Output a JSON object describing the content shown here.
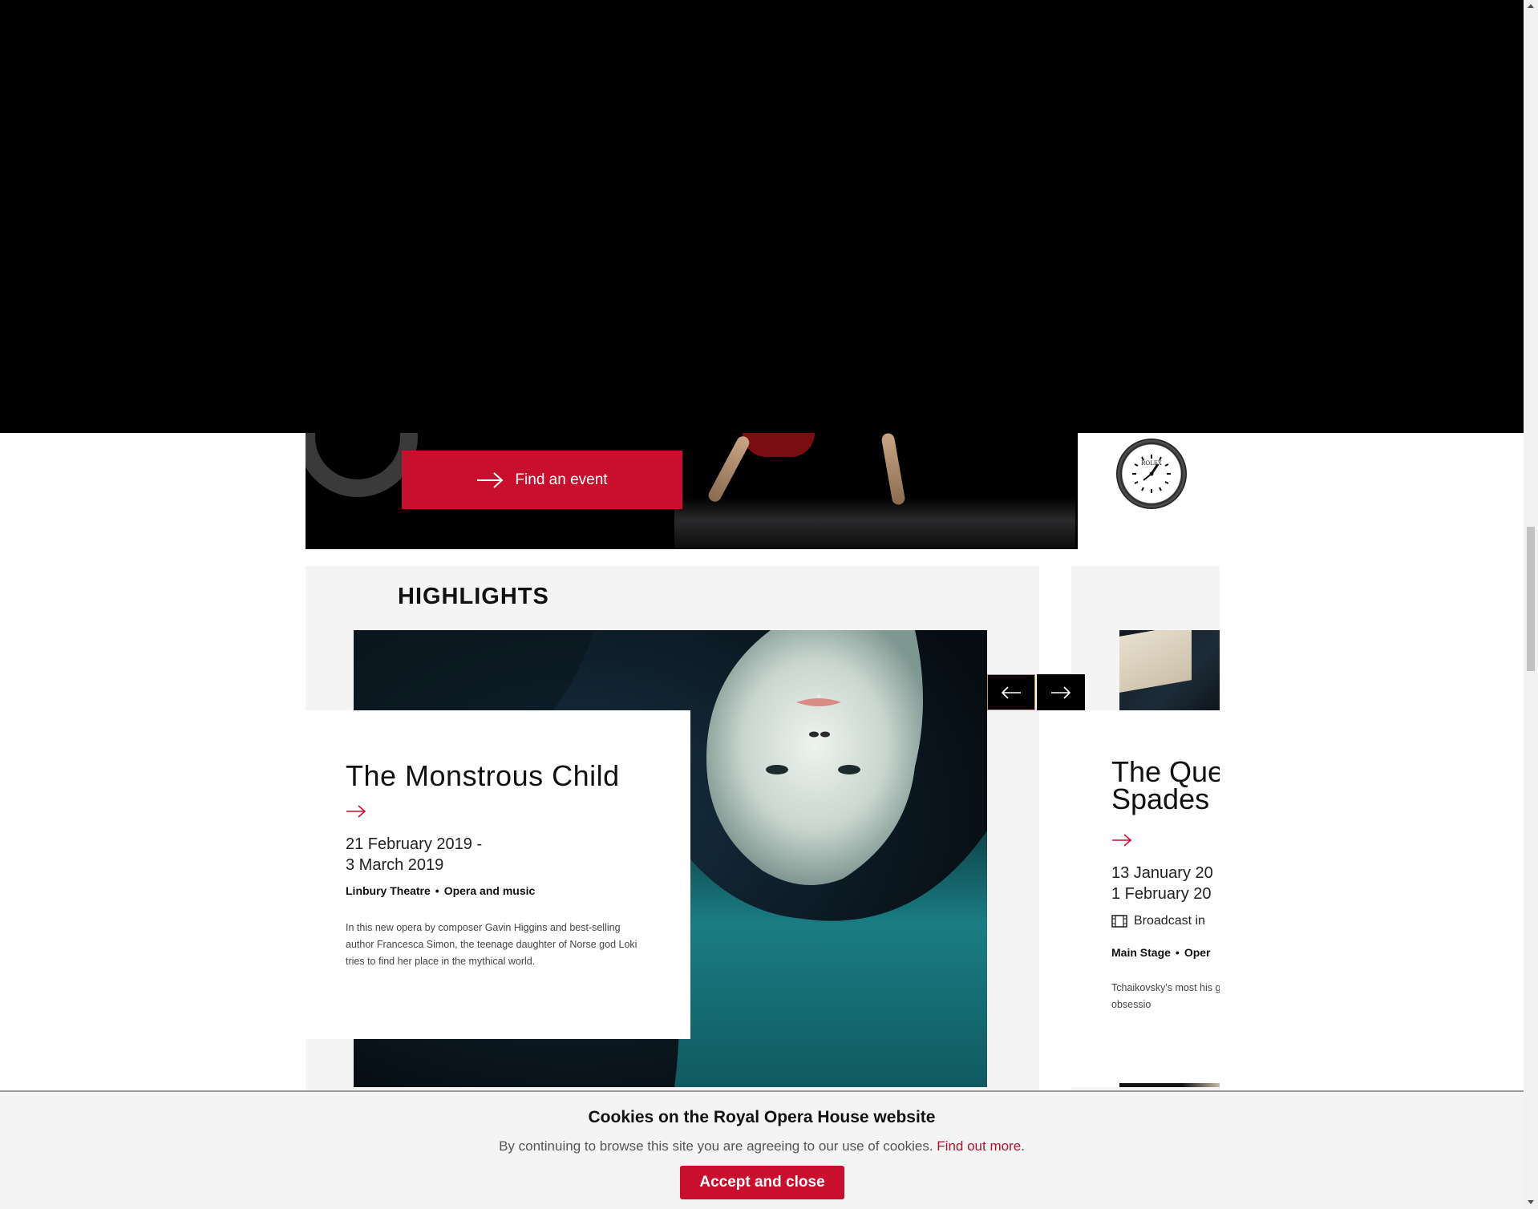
{
  "hero": {
    "find_button_label": "Find an event"
  },
  "sponsor": {
    "logo_text": "ROLEX"
  },
  "highlights": {
    "title": "HIGHLIGHTS",
    "items": [
      {
        "title": "The Monstrous Child",
        "date_line1": "21 February 2019 -",
        "date_line2": "3 March 2019",
        "venue": "Linbury Theatre",
        "category": "Opera and music",
        "description": "In this new opera by composer Gavin Higgins and best-selling author Francesca Simon, the teenage daughter of Norse god Loki tries to find her place in the mythical world."
      },
      {
        "title_line1": "The Que",
        "title_line2": "Spades",
        "date_line1": "13 January 20",
        "date_line2": "1 February 20",
        "broadcast": "Broadcast in",
        "venue": "Main Stage",
        "category": "Oper",
        "description": "Tchaikovsky's most his greatest music a destructive obsessio"
      }
    ]
  },
  "cookie_banner": {
    "title": "Cookies on the Royal Opera House website",
    "text": "By continuing to browse this site you are agreeing to our use of cookies.",
    "link_label": "Find out more.",
    "button_label": "Accept and close"
  },
  "colors": {
    "brand_red": "#c8102e",
    "panel_grey": "#f4f4f4",
    "focus_gold": "#c79a2a"
  }
}
